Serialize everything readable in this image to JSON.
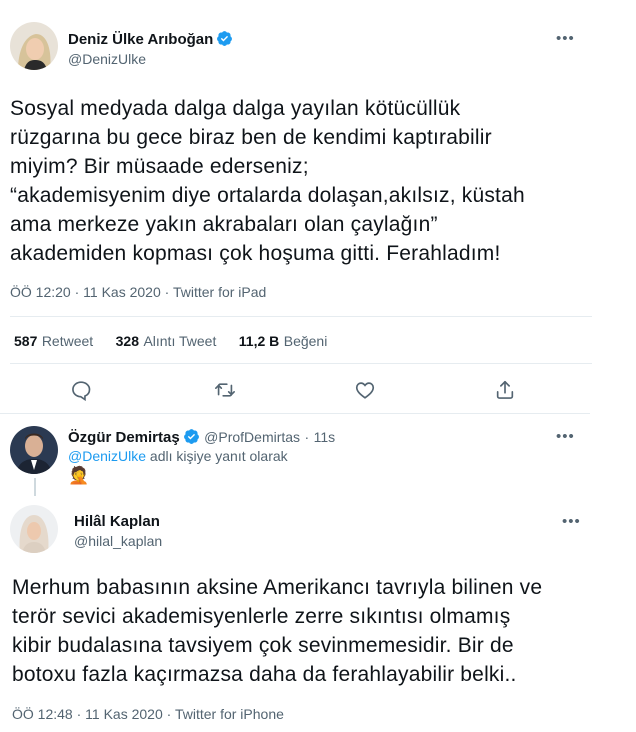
{
  "tweet1": {
    "name": "Deniz Ülke Arıboğan",
    "handle": "@DenizUlke",
    "text_lines": [
      "Sosyal medyada dalga dalga yayılan kötücüllük",
      "rüzgarına bu gece biraz ben de kendimi kaptırabilir",
      "miyim? Bir müsaade ederseniz;",
      "“akademisyenim diye ortalarda dolaşan,akılsız, küstah",
      "ama merkeze yakın akrabaları olan çaylağın”",
      "akademiden kopması çok hoşuma gitti. Ferahladım!"
    ],
    "time": "ÖÖ 12:20",
    "date": "11 Kas 2020",
    "source": "Twitter for iPad",
    "sep": "·",
    "stats": {
      "retweets": "587",
      "retweets_label": "Retweet",
      "quotes": "328",
      "quotes_label": "Alıntı Tweet",
      "likes": "11,2 B",
      "likes_label": "Beğeni"
    },
    "more": "•••"
  },
  "reply": {
    "name": "Özgür Demirtaş",
    "handle": "@ProfDemirtas",
    "sep": "·",
    "ago": "11s",
    "reply_to_handle": "@DenizUlke",
    "reply_to_suffix": " adlı kişiye yanıt olarak",
    "emoji": "🤦",
    "more": "•••"
  },
  "tweet2": {
    "name": "Hilâl Kaplan",
    "handle": "@hilal_kaplan",
    "text_lines": [
      "Merhum babasının aksine Amerikancı tavrıyla bilinen ve",
      "terör sevici akademisyenlerle zerre sıkıntısı olmamış",
      "kibir budalasına tavsiyem çok sevinmemesidir. Bir de",
      "botoxu fazla kaçırmazsa daha da ferahlayabilir belki.."
    ],
    "time": "ÖÖ 12:48",
    "date": "11 Kas 2020",
    "source": "Twitter for iPhone",
    "sep": "·",
    "more": "•••"
  },
  "colors": {
    "verified": "#1d9bf0",
    "link": "#1d9bf0",
    "muted": "#536471",
    "divider": "#e6ecf0"
  },
  "icons": [
    "verified-badge-icon",
    "more-icon",
    "reply-icon",
    "retweet-icon",
    "like-icon",
    "share-icon"
  ]
}
